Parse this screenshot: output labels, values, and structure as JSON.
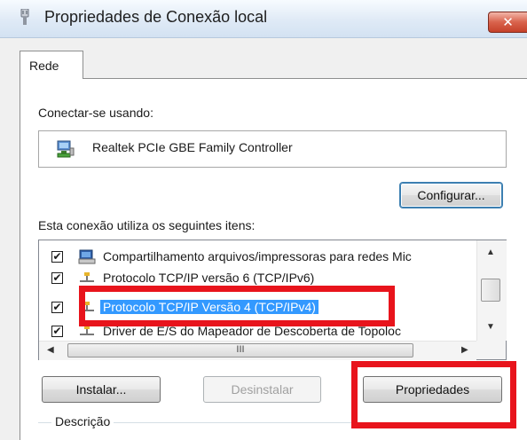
{
  "window": {
    "title": "Propriedades de Conexão local",
    "close_glyph": "✕"
  },
  "tabs": [
    {
      "label": "Rede",
      "active": true
    }
  ],
  "connect_using": {
    "label": "Conectar-se usando:",
    "adapter": "Realtek PCIe GBE Family Controller",
    "adapter_icon": "network-adapter-icon"
  },
  "buttons": {
    "configure": "Configurar...",
    "install": "Instalar...",
    "uninstall": "Desinstalar",
    "properties": "Propriedades"
  },
  "items": {
    "label": "Esta conexão utiliza os seguintes itens:",
    "list": [
      {
        "checked": true,
        "icon": "printer-share-icon",
        "label": "Compartilhamento arquivos/impressoras para redes Mic",
        "selected": false
      },
      {
        "checked": true,
        "icon": "protocol-icon",
        "label": "Protocolo TCP/IP versão 6 (TCP/IPv6)",
        "selected": false
      },
      {
        "checked": true,
        "icon": "protocol-icon",
        "label": "Protocolo TCP/IP Versão 4 (TCP/IPv4)",
        "selected": true
      },
      {
        "checked": true,
        "icon": "protocol-icon",
        "label": "Driver de E/S do Mapeador de Descoberta de Topoloc",
        "selected": false
      }
    ],
    "check_glyph": "✔",
    "scroll_up": "▲",
    "scroll_down": "▼",
    "scroll_left": "◀",
    "scroll_right": "▶",
    "scroll_grip": "III"
  },
  "description": {
    "label": "Descrição"
  },
  "colors": {
    "highlight": "#e8141c",
    "selection": "#3399ff"
  }
}
